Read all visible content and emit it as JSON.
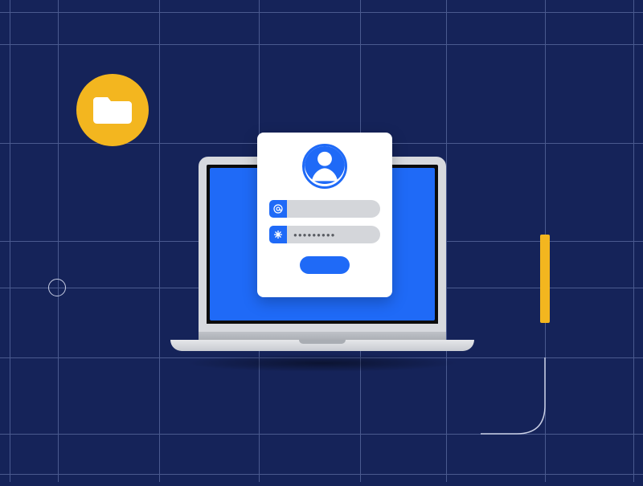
{
  "decor": {
    "folder_icon": "folder-icon",
    "small_circle": "circle-decoration",
    "yellow_bar": "accent-bar",
    "curve": "connector-curve"
  },
  "laptop": {
    "name": "laptop-illustration"
  },
  "login": {
    "avatar": "user-avatar-icon",
    "email": {
      "icon": "at-icon",
      "value": ""
    },
    "password": {
      "icon": "asterisk-icon",
      "value": "●●●●●●●●●"
    },
    "submit_label": ""
  },
  "colors": {
    "bg": "#152359",
    "accent": "#f3b61f",
    "primary": "#1f6af7"
  }
}
